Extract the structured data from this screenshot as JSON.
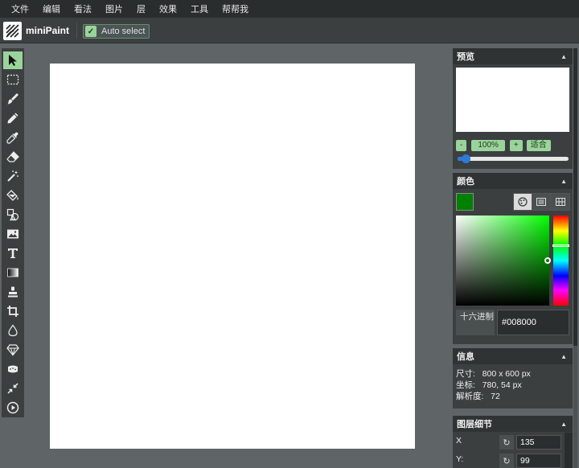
{
  "menu": [
    "文件",
    "编辑",
    "看法",
    "图片",
    "层",
    "效果",
    "工具",
    "帮帮我"
  ],
  "header": {
    "app_title": "miniPaint",
    "auto_select_label": "Auto select",
    "auto_select_checked": true
  },
  "tools": [
    {
      "name": "select-tool",
      "icon": "cursor-icon",
      "active": true
    },
    {
      "name": "selection-tool",
      "icon": "dashed-rect-icon"
    },
    {
      "name": "brush-tool",
      "icon": "brush-icon"
    },
    {
      "name": "pencil-tool",
      "icon": "pencil-icon"
    },
    {
      "name": "color-picker-tool",
      "icon": "eyedropper-icon"
    },
    {
      "name": "erase-tool",
      "icon": "eraser-icon"
    },
    {
      "name": "magic-wand-tool",
      "icon": "magic-wand-icon"
    },
    {
      "name": "fill-tool",
      "icon": "paint-bucket-icon"
    },
    {
      "name": "shape-tool",
      "icon": "shapes-icon"
    },
    {
      "name": "media-tool",
      "icon": "image-icon"
    },
    {
      "name": "text-tool",
      "icon": "text-icon"
    },
    {
      "name": "gradient-tool",
      "icon": "gradient-icon"
    },
    {
      "name": "clone-tool",
      "icon": "stamp-icon"
    },
    {
      "name": "crop-tool",
      "icon": "crop-icon"
    },
    {
      "name": "blur-tool",
      "icon": "drop-icon"
    },
    {
      "name": "sharpen-tool",
      "icon": "diamond-icon"
    },
    {
      "name": "desaturate-tool",
      "icon": "sponge-icon"
    },
    {
      "name": "bulge-pinch-tool",
      "icon": "compress-arrows-icon"
    },
    {
      "name": "animation-tool",
      "icon": "play-icon"
    }
  ],
  "preview": {
    "title": "预览",
    "zoom_out": "-",
    "zoom_value": "100%",
    "zoom_in": "+",
    "fit": "适合",
    "zoom_slider_fraction": 0.07
  },
  "colors": {
    "title": "颜色",
    "current_color": "#008000",
    "hex_label": "十六进制",
    "hex_value": "#008000",
    "saturation": 1.0,
    "value": 0.5,
    "hue_fraction": 0.333
  },
  "information": {
    "title": "信息",
    "size_line": "尺寸:   800 x 600 px",
    "coords_line": "坐标:   780, 54 px",
    "resolution_line": "解析度:   72"
  },
  "layer_details": {
    "title": "图层细节",
    "x_label": "X",
    "x_value": "135",
    "y_label": "Y:",
    "y_value": "99"
  },
  "theme": {
    "accent": "#9ad49a",
    "slider_blue": "#2e7bd6"
  }
}
